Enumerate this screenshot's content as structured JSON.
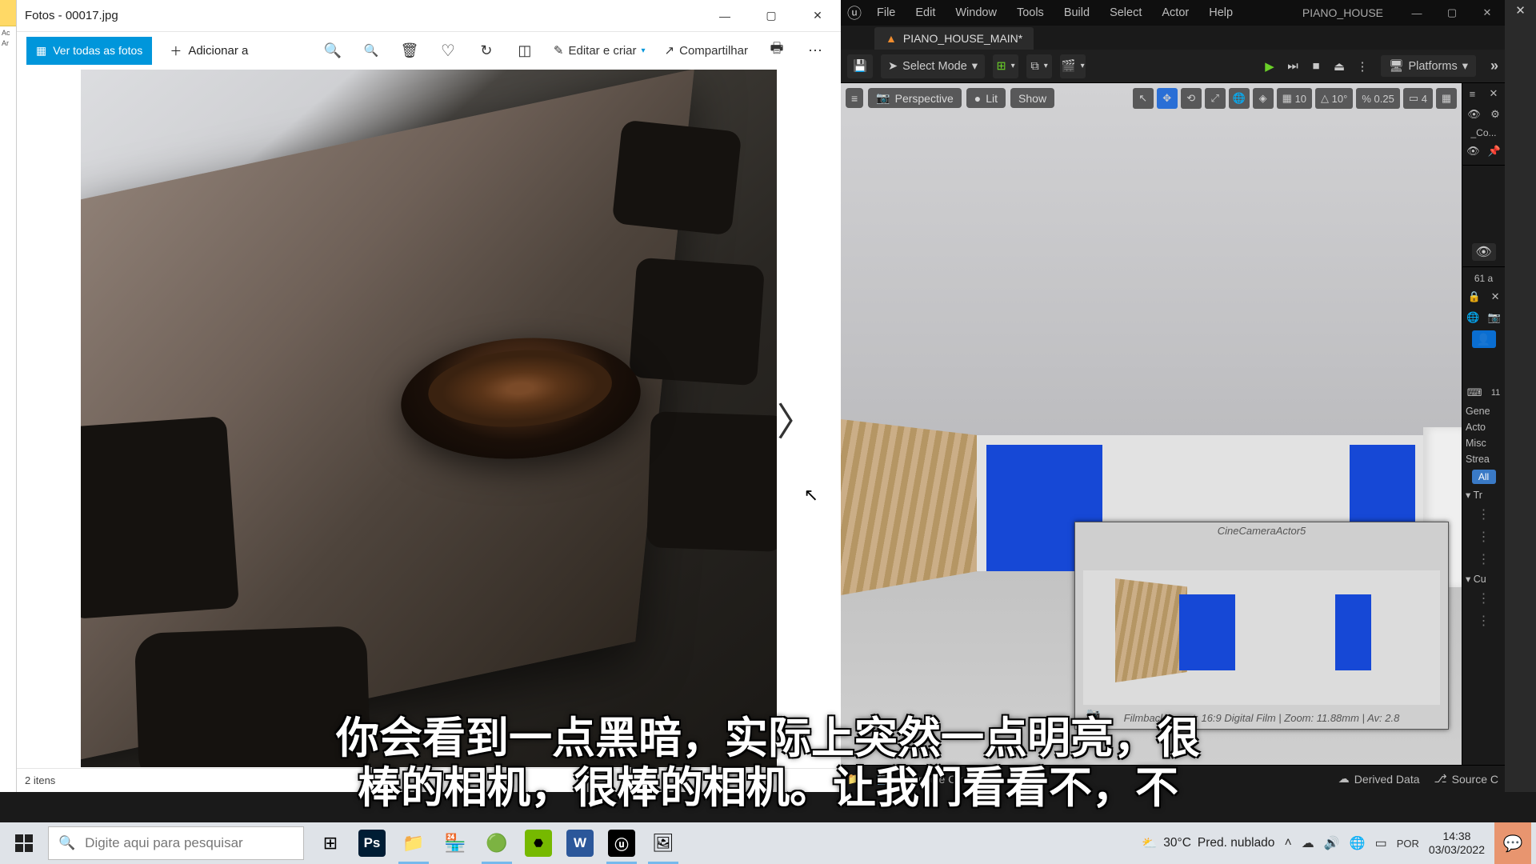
{
  "left_sliver": {
    "t1": "Ac",
    "t2": "Ar"
  },
  "photos": {
    "window_title": "Fotos - 00017.jpg",
    "all_photos_label": "Ver todas as fotos",
    "add_to_label": "Adicionar a",
    "edit_label": "Editar e criar",
    "share_label": "Compartilhar",
    "status": "2 itens"
  },
  "ue": {
    "menu": [
      "File",
      "Edit",
      "Window",
      "Tools",
      "Build",
      "Select",
      "Actor",
      "Help"
    ],
    "project": "PIANO_HOUSE",
    "tab": "PIANO_HOUSE_MAIN*",
    "select_mode": "Select Mode",
    "platforms": "Platforms",
    "viewport": {
      "perspective": "Perspective",
      "lit": "Lit",
      "show": "Show",
      "grid": "10",
      "angle": "10°",
      "scale": "0.25",
      "cams": "4"
    },
    "cam_preview": {
      "title": "CineCameraActor5",
      "info": "FilmbackPreset: 16:9 Digital Film | Zoom: 11.88mm | Av: 2.8"
    },
    "side": {
      "co_label": "_Co...",
      "count": "61 a",
      "cats": [
        "Gene",
        "Acto",
        "Misc",
        "Strea"
      ],
      "all": "All",
      "tr": "Tr",
      "cu": "Cu"
    },
    "bottom": {
      "console": "Console  Cmd",
      "derived": "Derived Data",
      "source": "Source C"
    }
  },
  "subtitle_line1": "你会看到一点黑暗，实际上突然一点明亮，很",
  "subtitle_line2": "棒的相机，很棒的相机。让我们看看不，不",
  "taskbar": {
    "search_placeholder": "Digite aqui para pesquisar",
    "weather_temp": "30°C",
    "weather_text": "Pred. nublado",
    "time": "14:38",
    "date": "03/03/2022"
  }
}
